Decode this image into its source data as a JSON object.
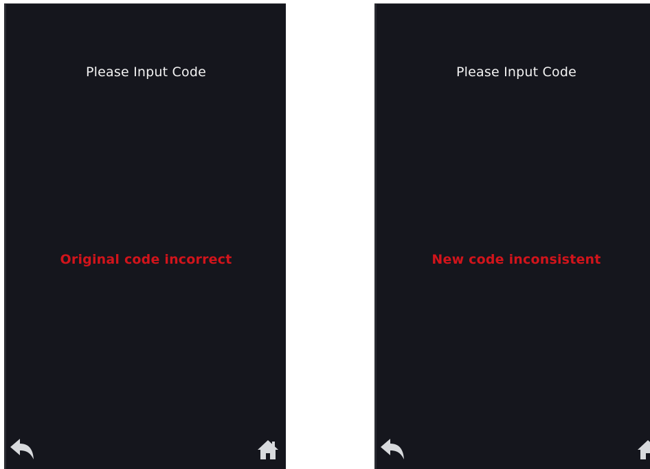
{
  "screens": [
    {
      "prompt": "Please Input Code",
      "error_message": "Original code incorrect",
      "back_icon": "back-arrow-icon",
      "home_icon": "home-icon"
    },
    {
      "prompt": "Please Input Code",
      "error_message": "New code inconsistent",
      "back_icon": "back-arrow-icon",
      "home_icon": "home-icon"
    }
  ],
  "colors": {
    "screen_background": "#15161d",
    "prompt_text": "#f2f2f2",
    "error_text": "#d1141b",
    "icon": "#d8dadd"
  }
}
